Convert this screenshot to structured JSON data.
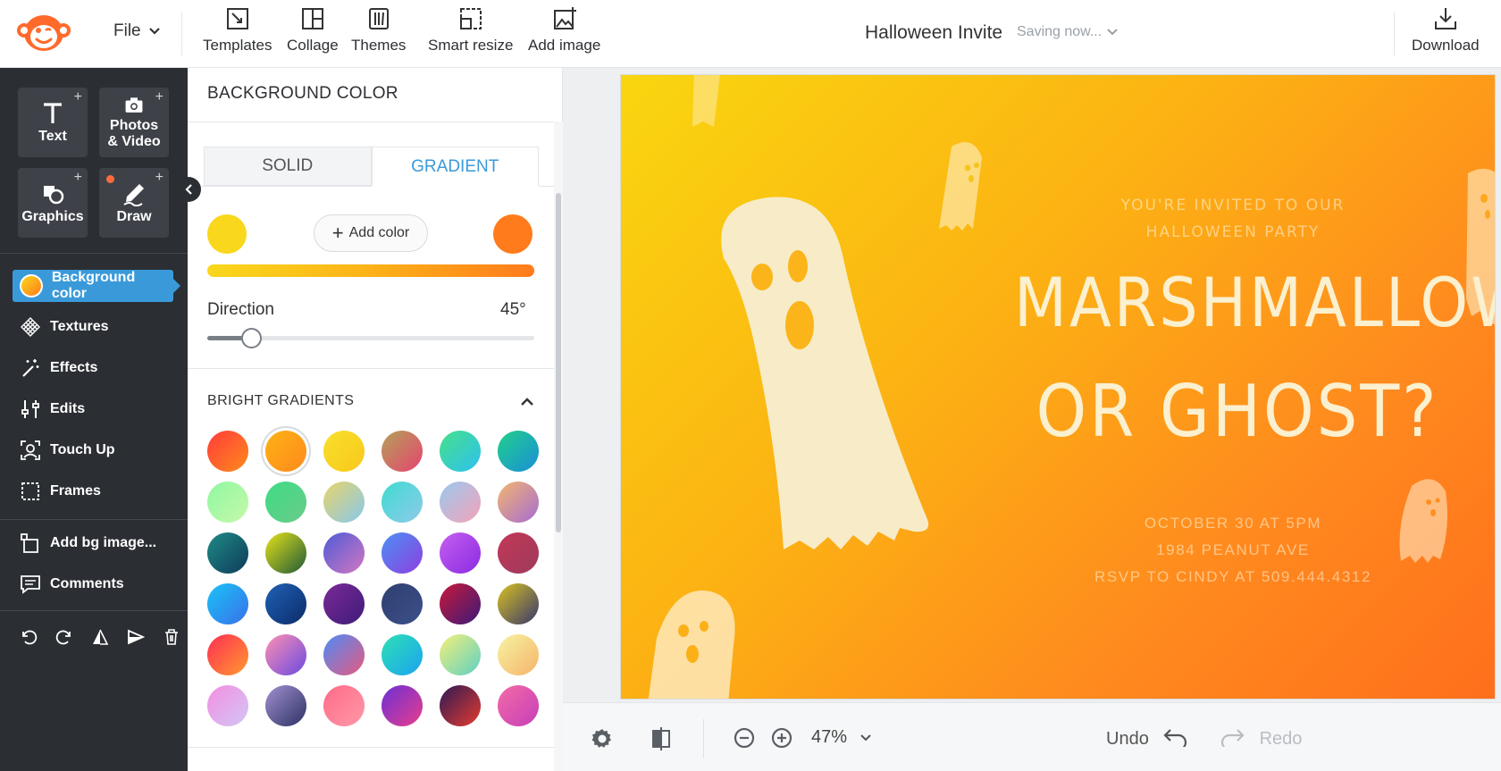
{
  "topbar": {
    "file_label": "File",
    "tools": [
      {
        "label": "Templates",
        "icon": "templates-icon"
      },
      {
        "label": "Collage",
        "icon": "collage-icon"
      },
      {
        "label": "Themes",
        "icon": "themes-icon"
      },
      {
        "label": "Smart resize",
        "icon": "smart-resize-icon"
      },
      {
        "label": "Add image",
        "icon": "add-image-icon"
      }
    ],
    "doc_title": "Halloween Invite",
    "saving_status": "Saving now...",
    "download_label": "Download"
  },
  "leftnav": {
    "tiles": [
      {
        "label": "Text"
      },
      {
        "label": "Photos\n& Video"
      },
      {
        "label": "Graphics"
      },
      {
        "label": "Draw"
      }
    ],
    "items": [
      {
        "label": "Background color"
      },
      {
        "label": "Textures"
      },
      {
        "label": "Effects"
      },
      {
        "label": "Edits"
      },
      {
        "label": "Touch Up"
      },
      {
        "label": "Frames"
      },
      {
        "label": "Add bg image..."
      },
      {
        "label": "Comments"
      }
    ]
  },
  "panel": {
    "title": "BACKGROUND COLOR",
    "tabs": {
      "solid": "SOLID",
      "gradient": "GRADIENT"
    },
    "add_color_label": "Add color",
    "stop_colors": {
      "start": "#f9d71c",
      "end": "#ff7b1c"
    },
    "direction_label": "Direction",
    "direction_value": "45°",
    "direction_fraction": 0.135,
    "section_title": "BRIGHT GRADIENTS",
    "selected_index": 1,
    "gradients": [
      [
        "#ff3b3b",
        "#ff8a1c"
      ],
      [
        "#fcb213",
        "#ff8a1e"
      ],
      [
        "#f7e02a",
        "#f9c81c"
      ],
      [
        "#b4a15a",
        "#e5446f"
      ],
      [
        "#46e089",
        "#2ec1f0"
      ],
      [
        "#21d08a",
        "#1a8fd8"
      ],
      [
        "#8ff7a3",
        "#c6f9a8"
      ],
      [
        "#3ddc84",
        "#6acb8a"
      ],
      [
        "#e8d46a",
        "#88c9ec"
      ],
      [
        "#3edcd0",
        "#8fc9ea"
      ],
      [
        "#9ac8ee",
        "#f5a3b9"
      ],
      [
        "#f3b66f",
        "#a66bd3"
      ],
      [
        "#1e8c85",
        "#0f3a5b"
      ],
      [
        "#e6e21a",
        "#1e5a37"
      ],
      [
        "#4e5bd8",
        "#d377c1"
      ],
      [
        "#4b90f4",
        "#8f3fe0"
      ],
      [
        "#c65ff0",
        "#8a2be2"
      ],
      [
        "#c23857",
        "#9e3a5c"
      ],
      [
        "#18c4f6",
        "#3a6fe9"
      ],
      [
        "#1f61b5",
        "#0c2c6a"
      ],
      [
        "#7b2a98",
        "#3e1a78"
      ],
      [
        "#2f3f6f",
        "#3c4f8a"
      ],
      [
        "#c8193a",
        "#3b1a78"
      ],
      [
        "#d9c221",
        "#37366d"
      ],
      [
        "#ff2d55",
        "#ff9a2e"
      ],
      [
        "#ff8fb3",
        "#6a4be0"
      ],
      [
        "#4d8cf7",
        "#e8597f"
      ],
      [
        "#2fe0b4",
        "#1aa3f0"
      ],
      [
        "#f4f07a",
        "#5ed0c2"
      ],
      [
        "#f7f4a3",
        "#f5b36a"
      ],
      [
        "#f48ee0",
        "#d2c6f5"
      ],
      [
        "#a38fd1",
        "#2c3264"
      ],
      [
        "#ff6a88",
        "#ff99a8"
      ],
      [
        "#6b2fd6",
        "#e83e8c"
      ],
      [
        "#2c1a55",
        "#e53a2f"
      ],
      [
        "#f46ba5",
        "#c53fb9"
      ]
    ]
  },
  "card": {
    "invite_lines": [
      "YOU'RE INVITED TO OUR",
      "HALLOWEEN PARTY"
    ],
    "headline_lines": [
      "MARSHMALLOW",
      "OR GHOST?"
    ],
    "detail_lines": [
      "OCTOBER 30 AT 5PM",
      "1984 PEANUT AVE",
      "RSVP TO CINDY AT 509.444.4312"
    ]
  },
  "bottombar": {
    "zoom_value": "47%",
    "undo_label": "Undo",
    "redo_label": "Redo"
  }
}
